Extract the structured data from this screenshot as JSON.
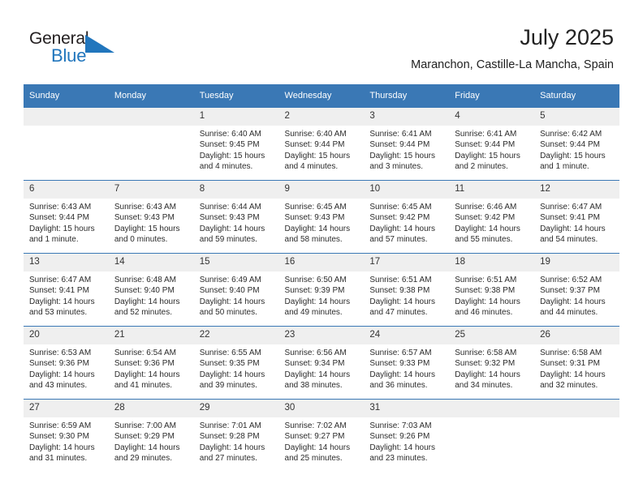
{
  "brand": {
    "name_top": "General",
    "name_bottom": "Blue",
    "triangle_icon": "blue-triangle-logo-mark",
    "accent_color": "#2176bd"
  },
  "header": {
    "title": "July 2025",
    "subtitle": "Maranchon, Castille-La Mancha, Spain"
  },
  "theme": {
    "header_row_bg": "#3a78b5",
    "daynum_bg": "#efefef",
    "text": "#2b2b2b"
  },
  "weekdays": [
    "Sunday",
    "Monday",
    "Tuesday",
    "Wednesday",
    "Thursday",
    "Friday",
    "Saturday"
  ],
  "weeks": [
    [
      {
        "day": "",
        "empty": true
      },
      {
        "day": "",
        "empty": true
      },
      {
        "day": "1",
        "sunrise": "Sunrise: 6:40 AM",
        "sunset": "Sunset: 9:45 PM",
        "daylight_1": "Daylight: 15 hours",
        "daylight_2": "and 4 minutes."
      },
      {
        "day": "2",
        "sunrise": "Sunrise: 6:40 AM",
        "sunset": "Sunset: 9:44 PM",
        "daylight_1": "Daylight: 15 hours",
        "daylight_2": "and 4 minutes."
      },
      {
        "day": "3",
        "sunrise": "Sunrise: 6:41 AM",
        "sunset": "Sunset: 9:44 PM",
        "daylight_1": "Daylight: 15 hours",
        "daylight_2": "and 3 minutes."
      },
      {
        "day": "4",
        "sunrise": "Sunrise: 6:41 AM",
        "sunset": "Sunset: 9:44 PM",
        "daylight_1": "Daylight: 15 hours",
        "daylight_2": "and 2 minutes."
      },
      {
        "day": "5",
        "sunrise": "Sunrise: 6:42 AM",
        "sunset": "Sunset: 9:44 PM",
        "daylight_1": "Daylight: 15 hours",
        "daylight_2": "and 1 minute."
      }
    ],
    [
      {
        "day": "6",
        "sunrise": "Sunrise: 6:43 AM",
        "sunset": "Sunset: 9:44 PM",
        "daylight_1": "Daylight: 15 hours",
        "daylight_2": "and 1 minute."
      },
      {
        "day": "7",
        "sunrise": "Sunrise: 6:43 AM",
        "sunset": "Sunset: 9:43 PM",
        "daylight_1": "Daylight: 15 hours",
        "daylight_2": "and 0 minutes."
      },
      {
        "day": "8",
        "sunrise": "Sunrise: 6:44 AM",
        "sunset": "Sunset: 9:43 PM",
        "daylight_1": "Daylight: 14 hours",
        "daylight_2": "and 59 minutes."
      },
      {
        "day": "9",
        "sunrise": "Sunrise: 6:45 AM",
        "sunset": "Sunset: 9:43 PM",
        "daylight_1": "Daylight: 14 hours",
        "daylight_2": "and 58 minutes."
      },
      {
        "day": "10",
        "sunrise": "Sunrise: 6:45 AM",
        "sunset": "Sunset: 9:42 PM",
        "daylight_1": "Daylight: 14 hours",
        "daylight_2": "and 57 minutes."
      },
      {
        "day": "11",
        "sunrise": "Sunrise: 6:46 AM",
        "sunset": "Sunset: 9:42 PM",
        "daylight_1": "Daylight: 14 hours",
        "daylight_2": "and 55 minutes."
      },
      {
        "day": "12",
        "sunrise": "Sunrise: 6:47 AM",
        "sunset": "Sunset: 9:41 PM",
        "daylight_1": "Daylight: 14 hours",
        "daylight_2": "and 54 minutes."
      }
    ],
    [
      {
        "day": "13",
        "sunrise": "Sunrise: 6:47 AM",
        "sunset": "Sunset: 9:41 PM",
        "daylight_1": "Daylight: 14 hours",
        "daylight_2": "and 53 minutes."
      },
      {
        "day": "14",
        "sunrise": "Sunrise: 6:48 AM",
        "sunset": "Sunset: 9:40 PM",
        "daylight_1": "Daylight: 14 hours",
        "daylight_2": "and 52 minutes."
      },
      {
        "day": "15",
        "sunrise": "Sunrise: 6:49 AM",
        "sunset": "Sunset: 9:40 PM",
        "daylight_1": "Daylight: 14 hours",
        "daylight_2": "and 50 minutes."
      },
      {
        "day": "16",
        "sunrise": "Sunrise: 6:50 AM",
        "sunset": "Sunset: 9:39 PM",
        "daylight_1": "Daylight: 14 hours",
        "daylight_2": "and 49 minutes."
      },
      {
        "day": "17",
        "sunrise": "Sunrise: 6:51 AM",
        "sunset": "Sunset: 9:38 PM",
        "daylight_1": "Daylight: 14 hours",
        "daylight_2": "and 47 minutes."
      },
      {
        "day": "18",
        "sunrise": "Sunrise: 6:51 AM",
        "sunset": "Sunset: 9:38 PM",
        "daylight_1": "Daylight: 14 hours",
        "daylight_2": "and 46 minutes."
      },
      {
        "day": "19",
        "sunrise": "Sunrise: 6:52 AM",
        "sunset": "Sunset: 9:37 PM",
        "daylight_1": "Daylight: 14 hours",
        "daylight_2": "and 44 minutes."
      }
    ],
    [
      {
        "day": "20",
        "sunrise": "Sunrise: 6:53 AM",
        "sunset": "Sunset: 9:36 PM",
        "daylight_1": "Daylight: 14 hours",
        "daylight_2": "and 43 minutes."
      },
      {
        "day": "21",
        "sunrise": "Sunrise: 6:54 AM",
        "sunset": "Sunset: 9:36 PM",
        "daylight_1": "Daylight: 14 hours",
        "daylight_2": "and 41 minutes."
      },
      {
        "day": "22",
        "sunrise": "Sunrise: 6:55 AM",
        "sunset": "Sunset: 9:35 PM",
        "daylight_1": "Daylight: 14 hours",
        "daylight_2": "and 39 minutes."
      },
      {
        "day": "23",
        "sunrise": "Sunrise: 6:56 AM",
        "sunset": "Sunset: 9:34 PM",
        "daylight_1": "Daylight: 14 hours",
        "daylight_2": "and 38 minutes."
      },
      {
        "day": "24",
        "sunrise": "Sunrise: 6:57 AM",
        "sunset": "Sunset: 9:33 PM",
        "daylight_1": "Daylight: 14 hours",
        "daylight_2": "and 36 minutes."
      },
      {
        "day": "25",
        "sunrise": "Sunrise: 6:58 AM",
        "sunset": "Sunset: 9:32 PM",
        "daylight_1": "Daylight: 14 hours",
        "daylight_2": "and 34 minutes."
      },
      {
        "day": "26",
        "sunrise": "Sunrise: 6:58 AM",
        "sunset": "Sunset: 9:31 PM",
        "daylight_1": "Daylight: 14 hours",
        "daylight_2": "and 32 minutes."
      }
    ],
    [
      {
        "day": "27",
        "sunrise": "Sunrise: 6:59 AM",
        "sunset": "Sunset: 9:30 PM",
        "daylight_1": "Daylight: 14 hours",
        "daylight_2": "and 31 minutes."
      },
      {
        "day": "28",
        "sunrise": "Sunrise: 7:00 AM",
        "sunset": "Sunset: 9:29 PM",
        "daylight_1": "Daylight: 14 hours",
        "daylight_2": "and 29 minutes."
      },
      {
        "day": "29",
        "sunrise": "Sunrise: 7:01 AM",
        "sunset": "Sunset: 9:28 PM",
        "daylight_1": "Daylight: 14 hours",
        "daylight_2": "and 27 minutes."
      },
      {
        "day": "30",
        "sunrise": "Sunrise: 7:02 AM",
        "sunset": "Sunset: 9:27 PM",
        "daylight_1": "Daylight: 14 hours",
        "daylight_2": "and 25 minutes."
      },
      {
        "day": "31",
        "sunrise": "Sunrise: 7:03 AM",
        "sunset": "Sunset: 9:26 PM",
        "daylight_1": "Daylight: 14 hours",
        "daylight_2": "and 23 minutes."
      },
      {
        "day": "",
        "empty": true
      },
      {
        "day": "",
        "empty": true
      }
    ]
  ]
}
